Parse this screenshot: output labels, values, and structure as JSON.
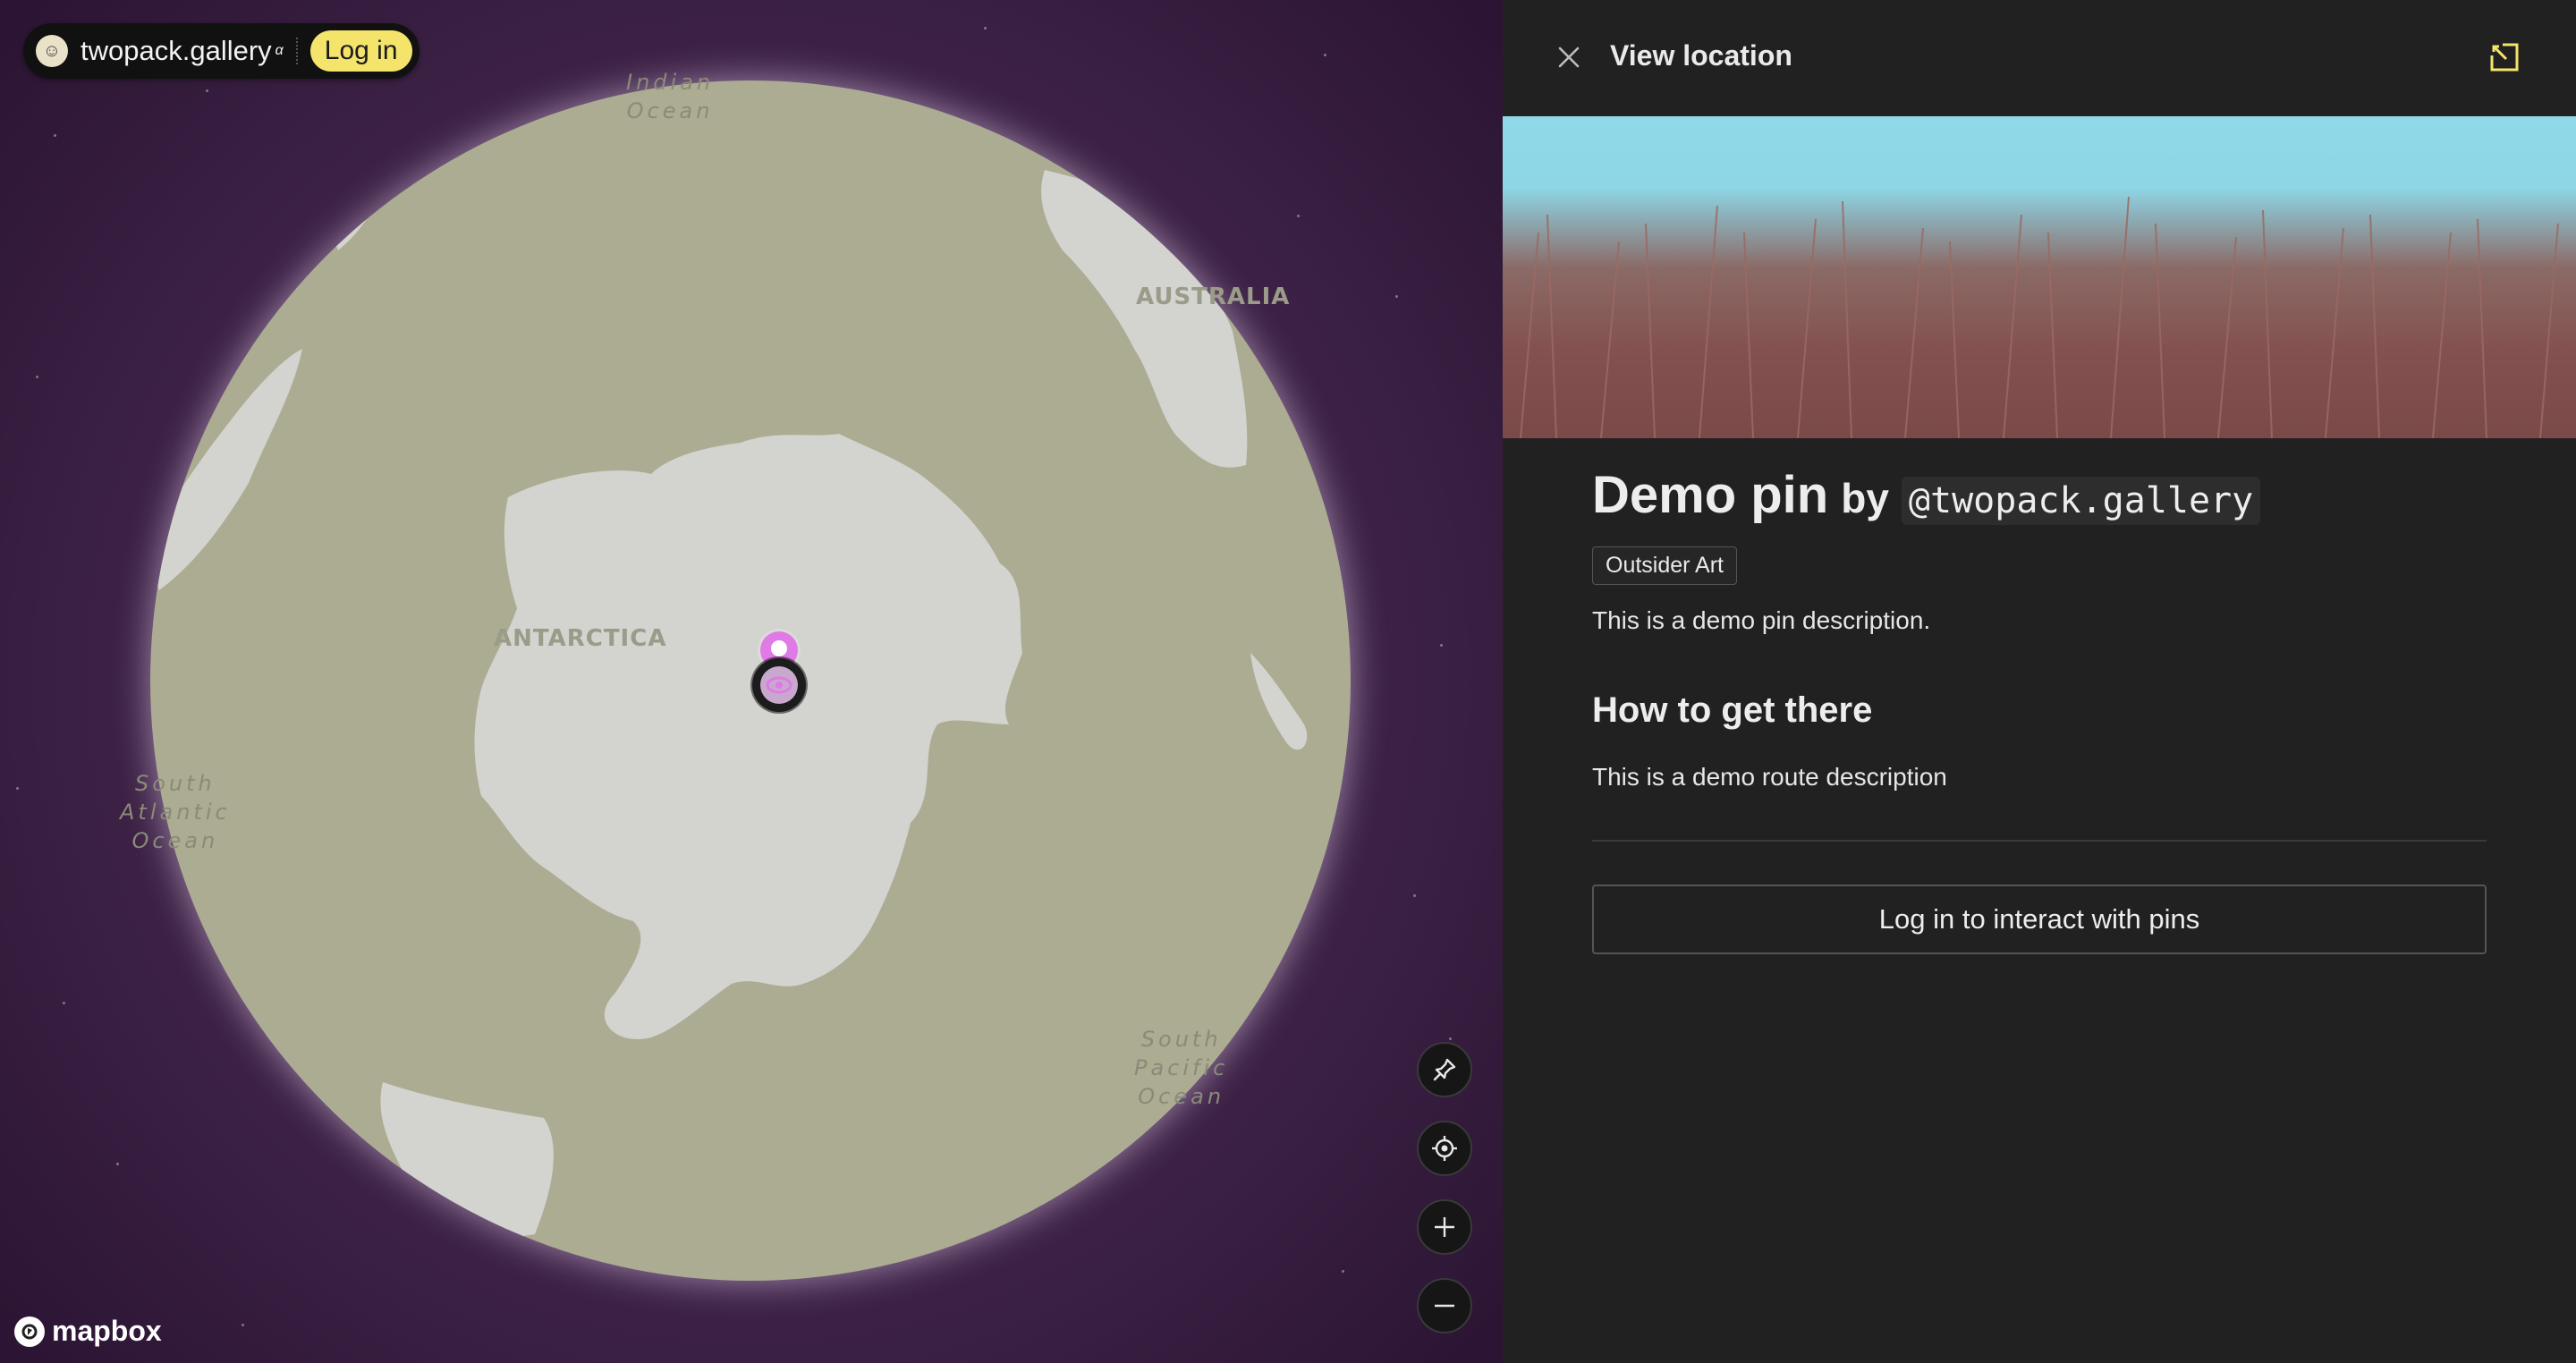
{
  "brand": {
    "name": "twopack.gallery",
    "superscript": "α",
    "login_label": "Log in"
  },
  "map": {
    "labels": {
      "indian_ocean_1": "Indian",
      "indian_ocean_2": "Ocean",
      "australia": "AUSTRALIA",
      "antarctica": "ANTARCTICA",
      "south_atlantic_1": "South",
      "south_atlantic_2": "Atlantic",
      "south_atlantic_3": "Ocean",
      "south_pacific_1": "South",
      "south_pacific_2": "Pacific",
      "south_pacific_3": "Ocean"
    },
    "attribution": "mapbox",
    "controls": [
      "pin-icon",
      "locate-icon",
      "zoom-in-icon",
      "zoom-out-icon"
    ],
    "colors": {
      "ocean": "#acac93",
      "land": "#d3d3cf",
      "space": "#3d2246",
      "pin": "#e07ae6"
    }
  },
  "panel": {
    "title": "View location",
    "pin": {
      "title": "Demo pin",
      "by": "by",
      "author": "@twopack.gallery",
      "tag": "Outsider Art",
      "description": "This is a demo pin description."
    },
    "route": {
      "heading": "How to get there",
      "description": "This is a demo route description"
    },
    "login_button": "Log in to interact with pins",
    "accent_color": "#f4e46b"
  }
}
